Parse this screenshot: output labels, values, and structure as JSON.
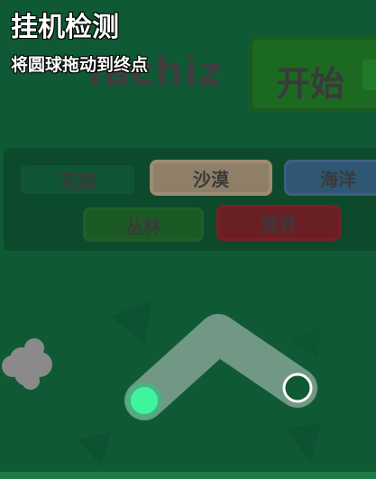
{
  "captcha": {
    "title": "挂机检测",
    "instruction": "将圆球拖动到终点"
  },
  "background": {
    "game_name_fragment": "lachiz",
    "start_button_label": "开始",
    "themes": [
      "花园",
      "沙漠",
      "海洋",
      "丛林",
      "冥界"
    ]
  },
  "colors": {
    "page_bg": "#0f5a35",
    "ball": "#3ef59d",
    "path": "#8aa69a",
    "goal_ring": "#ffffff"
  }
}
